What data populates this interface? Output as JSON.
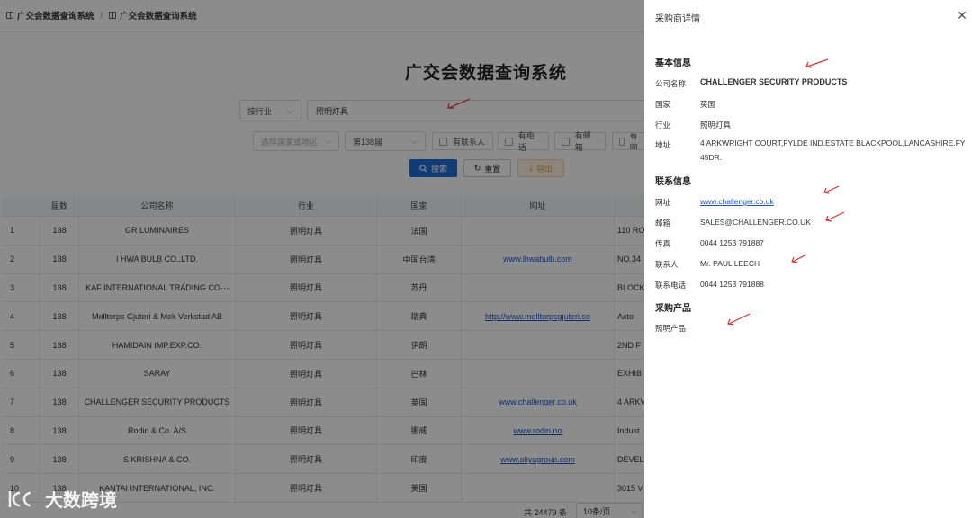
{
  "breadcrumb": {
    "items": [
      "广交会数据查询系统",
      "广交会数据查询系统"
    ],
    "separator": "/"
  },
  "page_title": "广交会数据查询系统",
  "filters": {
    "mode_select": "按行业",
    "keyword": "照明灯具",
    "region_placeholder": "选择国家或地区",
    "session": "第138届",
    "checkboxes": [
      "有联系人",
      "有电话",
      "有邮箱",
      "有网"
    ]
  },
  "buttons": {
    "search": "搜索",
    "reset": "重置",
    "export": "导出"
  },
  "table": {
    "headers": [
      "",
      "届数",
      "公司名称",
      "行业",
      "国家",
      "网址"
    ],
    "rows": [
      {
        "no": "1",
        "year": "138",
        "name": "GR LUMINAIRES",
        "industry": "照明灯具",
        "country": "法国",
        "website": "",
        "address": "110 RO"
      },
      {
        "no": "2",
        "year": "138",
        "name": "I HWA BULB CO.,LTD.",
        "industry": "照明灯具",
        "country": "中国台湾",
        "website": "www.ihwabulb.com",
        "address": "NO.34"
      },
      {
        "no": "3",
        "year": "138",
        "name": "KAF INTERNATIONAL TRADING CO···",
        "industry": "照明灯具",
        "country": "苏丹",
        "website": "",
        "address": "BLOCK"
      },
      {
        "no": "4",
        "year": "138",
        "name": "Molltorps Gjuteri & Mek Verkstad AB",
        "industry": "照明灯具",
        "country": "瑞典",
        "website": "http://www.molltorpsgjuteri.se",
        "address": "Axto"
      },
      {
        "no": "5",
        "year": "138",
        "name": "HAMIDAIN IMP.EXP.CO.",
        "industry": "照明灯具",
        "country": "伊朗",
        "website": "",
        "address": "2ND F"
      },
      {
        "no": "6",
        "year": "138",
        "name": "SARAY",
        "industry": "照明灯具",
        "country": "巴林",
        "website": "",
        "address": "EXHIB"
      },
      {
        "no": "7",
        "year": "138",
        "name": "CHALLENGER SECURITY PRODUCTS",
        "industry": "照明灯具",
        "country": "英国",
        "website": "www.challenger.co.uk",
        "address": "4 ARKV"
      },
      {
        "no": "8",
        "year": "138",
        "name": "Rodin & Co. A/S",
        "industry": "照明灯具",
        "country": "挪威",
        "website": "www.rodin.no",
        "address": "Indust"
      },
      {
        "no": "9",
        "year": "138",
        "name": "S.KRISHNA & CO.",
        "industry": "照明灯具",
        "country": "印度",
        "website": "www.oliyagroup.com",
        "address": "DEVEL"
      },
      {
        "no": "10",
        "year": "138",
        "name": "KANTAI INTERNATIONAL, INC.",
        "industry": "照明灯具",
        "country": "美国",
        "website": "",
        "address": "3015 V"
      }
    ]
  },
  "pagination": {
    "total": "共 24479 条",
    "page_size": "10条/页"
  },
  "watermark": "大数跨境",
  "drawer": {
    "title": "采购商详情",
    "basic_section": "基本信息",
    "contact_section": "联系信息",
    "product_section": "采购产品",
    "fields": {
      "company_label": "公司名称",
      "company": "CHALLENGER SECURITY PRODUCTS",
      "country_label": "国家",
      "country": "英国",
      "industry_label": "行业",
      "industry": "照明灯具",
      "address_label": "地址",
      "address": "4 ARKWRIGHT COURT,FYLDE IND.ESTATE BLACKPOOL,LANCASHIRE.FY45DR.",
      "website_label": "网址",
      "website": "www.challenger.co.uk",
      "email_label": "邮箱",
      "email": "SALES@CHALLENGER.CO.UK",
      "fax_label": "传真",
      "fax": "0044 1253 791887",
      "contact_label": "联系人",
      "contact": "Mr. PAUL LEECH",
      "phone_label": "联系电话",
      "phone": "0044 1253 791888",
      "product": "照明产品"
    }
  },
  "colors": {
    "primary": "#1e6fd9",
    "link": "#1e55c8",
    "annotation": "#e0332a",
    "overlay": "rgba(0,0,0,0.45)"
  }
}
